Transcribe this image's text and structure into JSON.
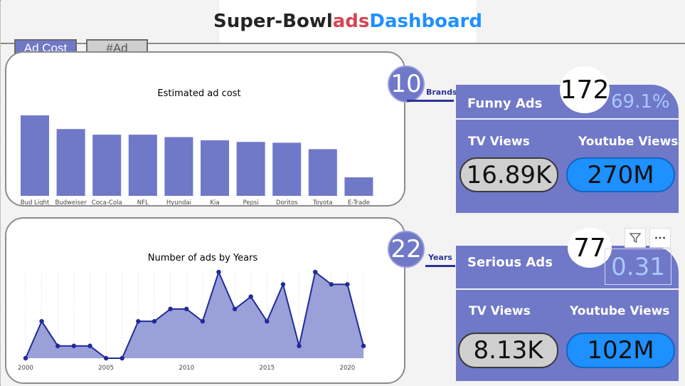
{
  "title": {
    "part1": "Super-Bowl ",
    "part2": "ads",
    "part3": " Dashboard"
  },
  "tabs": [
    {
      "label": "Ad Cost"
    },
    {
      "label": "#Ad"
    }
  ],
  "brands": {
    "count": "10",
    "label": "Brands"
  },
  "years": {
    "count": "22",
    "label": "Years"
  },
  "funny": {
    "title": "Funny Ads",
    "count": "172",
    "percent": "69.1%",
    "tv_label": "TV Views",
    "yt_label": "Youtube Views",
    "tv_value": "16.89K",
    "yt_value": "270M"
  },
  "serious": {
    "title": "Serious Ads",
    "count": "77",
    "ratio": "0.31",
    "tv_label": "TV Views",
    "yt_label": "Youtube Views",
    "tv_value": "8.13K",
    "yt_value": "102M"
  },
  "icons": {
    "filter": "filter-icon",
    "more": "more-options-icon"
  },
  "colors": {
    "accent": "#7078c8",
    "brand_red": "#d64550",
    "brand_blue": "#1e90ff",
    "pill_grey": "#cfcfcf",
    "line": "#1f2b99"
  },
  "chart_data": [
    {
      "type": "bar",
      "title": "Estimated ad cost",
      "categories": [
        "Bud Light",
        "Budweiser",
        "Coca-Cola",
        "NFL",
        "Hyundai",
        "Kia",
        "Pepsi",
        "Doritos",
        "Toyota",
        "E-Trade"
      ],
      "values": [
        100,
        83,
        76,
        76,
        73,
        69,
        67,
        66,
        58,
        23
      ],
      "ylim": [
        0,
        100
      ],
      "grid": false
    },
    {
      "type": "area",
      "title": "Number of ads by Years",
      "x": [
        2000,
        2001,
        2002,
        2003,
        2004,
        2005,
        2006,
        2007,
        2008,
        2009,
        2010,
        2011,
        2012,
        2013,
        2014,
        2015,
        2016,
        2017,
        2018,
        2019,
        2020,
        2021
      ],
      "values": [
        7,
        10,
        8,
        8,
        8,
        7,
        7,
        10,
        10,
        11,
        11,
        10,
        14,
        11,
        12,
        10,
        13,
        8,
        14,
        13,
        13,
        8
      ],
      "xticks": [
        "2000",
        "2005",
        "2010",
        "2015",
        "2020"
      ],
      "ylim": [
        7,
        14
      ],
      "grid": false
    }
  ]
}
